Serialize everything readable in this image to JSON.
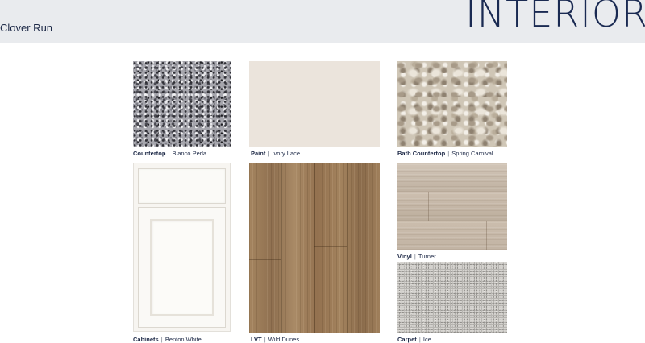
{
  "header": {
    "community": "Clover Run",
    "heading": "INTERIOR"
  },
  "swatches": {
    "countertop": {
      "label": "Countertop",
      "separator": "|",
      "value": "Blanco Perla"
    },
    "paint": {
      "label": "Paint",
      "separator": "|",
      "value": "Ivory Lace"
    },
    "bath_countertop": {
      "label": "Bath Countertop",
      "separator": "|",
      "value": "Spring Carnival"
    },
    "cabinets": {
      "label": "Cabinets",
      "separator": "|",
      "value": "Benton White"
    },
    "lvt": {
      "label": "LVT",
      "separator": "|",
      "value": "Wild Dunes"
    },
    "vinyl": {
      "label": "Vinyl",
      "separator": "|",
      "value": "Turner"
    },
    "carpet": {
      "label": "Carpet",
      "separator": "|",
      "value": "Ice"
    }
  },
  "colors": {
    "header_bg": "#e9ebee",
    "heading_text": "#1a2a52",
    "paint_swatch": "#ebe4dc"
  }
}
